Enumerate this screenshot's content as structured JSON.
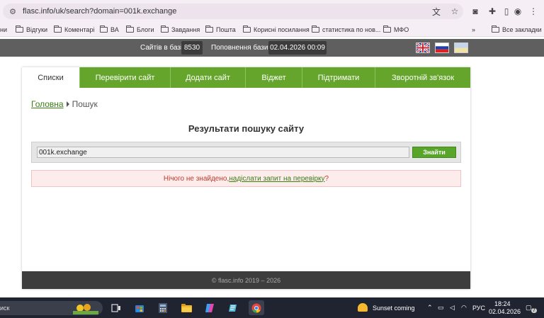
{
  "browser": {
    "url": "flasc.info/uk/search?domain=001k.exchange",
    "bookmarks": [
      "Відгуки",
      "Коментарі",
      "ВА",
      "Блоги",
      "Завдання",
      "Пошта",
      "Корисні посилання",
      "статистика по нов...",
      "МФО"
    ],
    "all_bookmarks": "Все закладки",
    "more": "»",
    "bm_lead": "ни"
  },
  "topbar": {
    "sites_label": "Сайтів в базі",
    "sites_count": "8530",
    "update_label": "Поповнення бази",
    "update_date": "02.04.2026 00:09"
  },
  "nav": {
    "tabs": [
      "Списки",
      "Перевірити сайт",
      "Додати сайт",
      "Віджет",
      "Підтримати",
      "Зворотній зв'язок"
    ]
  },
  "breadcrumb": {
    "home": "Головна",
    "current": "Пошук"
  },
  "search": {
    "title": "Результати пошуку сайту",
    "value": "001k.exchange",
    "button": "Знайти"
  },
  "alert": {
    "prefix": "Нічого не знайдено, ",
    "link": "надіслати запит на перевірку",
    "suffix": "?"
  },
  "footer": {
    "text": "© flasc.info 2019 – 2026"
  },
  "taskbar": {
    "search_text": "иск",
    "weather": "Sunset coming",
    "lang": "РУС",
    "time": "18:24",
    "date": "02.04.2026",
    "notif": "7"
  }
}
